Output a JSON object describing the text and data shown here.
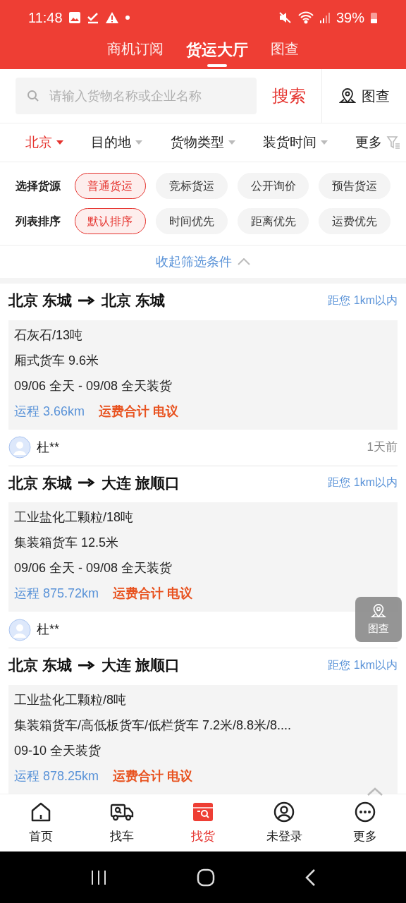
{
  "status_bar": {
    "time": "11:48",
    "battery": "39%"
  },
  "top_tabs": [
    {
      "label": "商机订阅",
      "selected": false
    },
    {
      "label": "货运大厅",
      "selected": true
    },
    {
      "label": "图查",
      "selected": false
    }
  ],
  "search": {
    "placeholder": "请输入货物名称或企业名称",
    "button": "搜索",
    "map_button": "图查"
  },
  "filters": [
    {
      "label": "北京",
      "selected": true
    },
    {
      "label": "目的地",
      "selected": false
    },
    {
      "label": "货物类型",
      "selected": false
    },
    {
      "label": "装货时间",
      "selected": false
    },
    {
      "label": "更多",
      "selected": false
    }
  ],
  "option_rows": [
    {
      "label": "选择货源",
      "options": [
        {
          "label": "普通货运",
          "selected": true
        },
        {
          "label": "竞标货运",
          "selected": false
        },
        {
          "label": "公开询价",
          "selected": false
        },
        {
          "label": "预告货运",
          "selected": false
        }
      ]
    },
    {
      "label": "列表排序",
      "options": [
        {
          "label": "默认排序",
          "selected": true
        },
        {
          "label": "时间优先",
          "selected": false
        },
        {
          "label": "距离优先",
          "selected": false
        },
        {
          "label": "运费优先",
          "selected": false
        }
      ]
    }
  ],
  "collapse": "收起筛选条件",
  "cards": [
    {
      "from": "北京 东城",
      "to": "北京 东城",
      "distance_to_you": "距您 1km以内",
      "cargo": "石灰石/13吨",
      "truck": "厢式货车 9.6米",
      "schedule": "09/06 全天 - 09/08 全天装货",
      "route": "运程 3.66km",
      "fee": "运费合计 电议",
      "user": "杜**",
      "time": "1天前"
    },
    {
      "from": "北京 东城",
      "to": "大连 旅顺口",
      "distance_to_you": "距您 1km以内",
      "cargo": "工业盐化工颗粒/18吨",
      "truck": "集装箱货车 12.5米",
      "schedule": "09/06 全天 - 09/08 全天装货",
      "route": "运程 875.72km",
      "fee": "运费合计 电议",
      "user": "杜**"
    },
    {
      "from": "北京 东城",
      "to": "大连 旅顺口",
      "distance_to_you": "距您 1km以内",
      "cargo": "工业盐化工颗粒/8吨",
      "truck": "集装箱货车/高低板货车/低栏货车 7.2米/8.8米/8....",
      "schedule": "09-10 全天装货",
      "route": "运程 878.25km",
      "fee": "运费合计 电议"
    }
  ],
  "floating_button": "图查",
  "bottom_nav": [
    {
      "label": "首页",
      "kind": "home",
      "selected": false
    },
    {
      "label": "找车",
      "kind": "truck",
      "selected": false
    },
    {
      "label": "找货",
      "kind": "box",
      "selected": true
    },
    {
      "label": "未登录",
      "kind": "user",
      "selected": false
    },
    {
      "label": "更多",
      "kind": "more",
      "selected": false
    }
  ]
}
